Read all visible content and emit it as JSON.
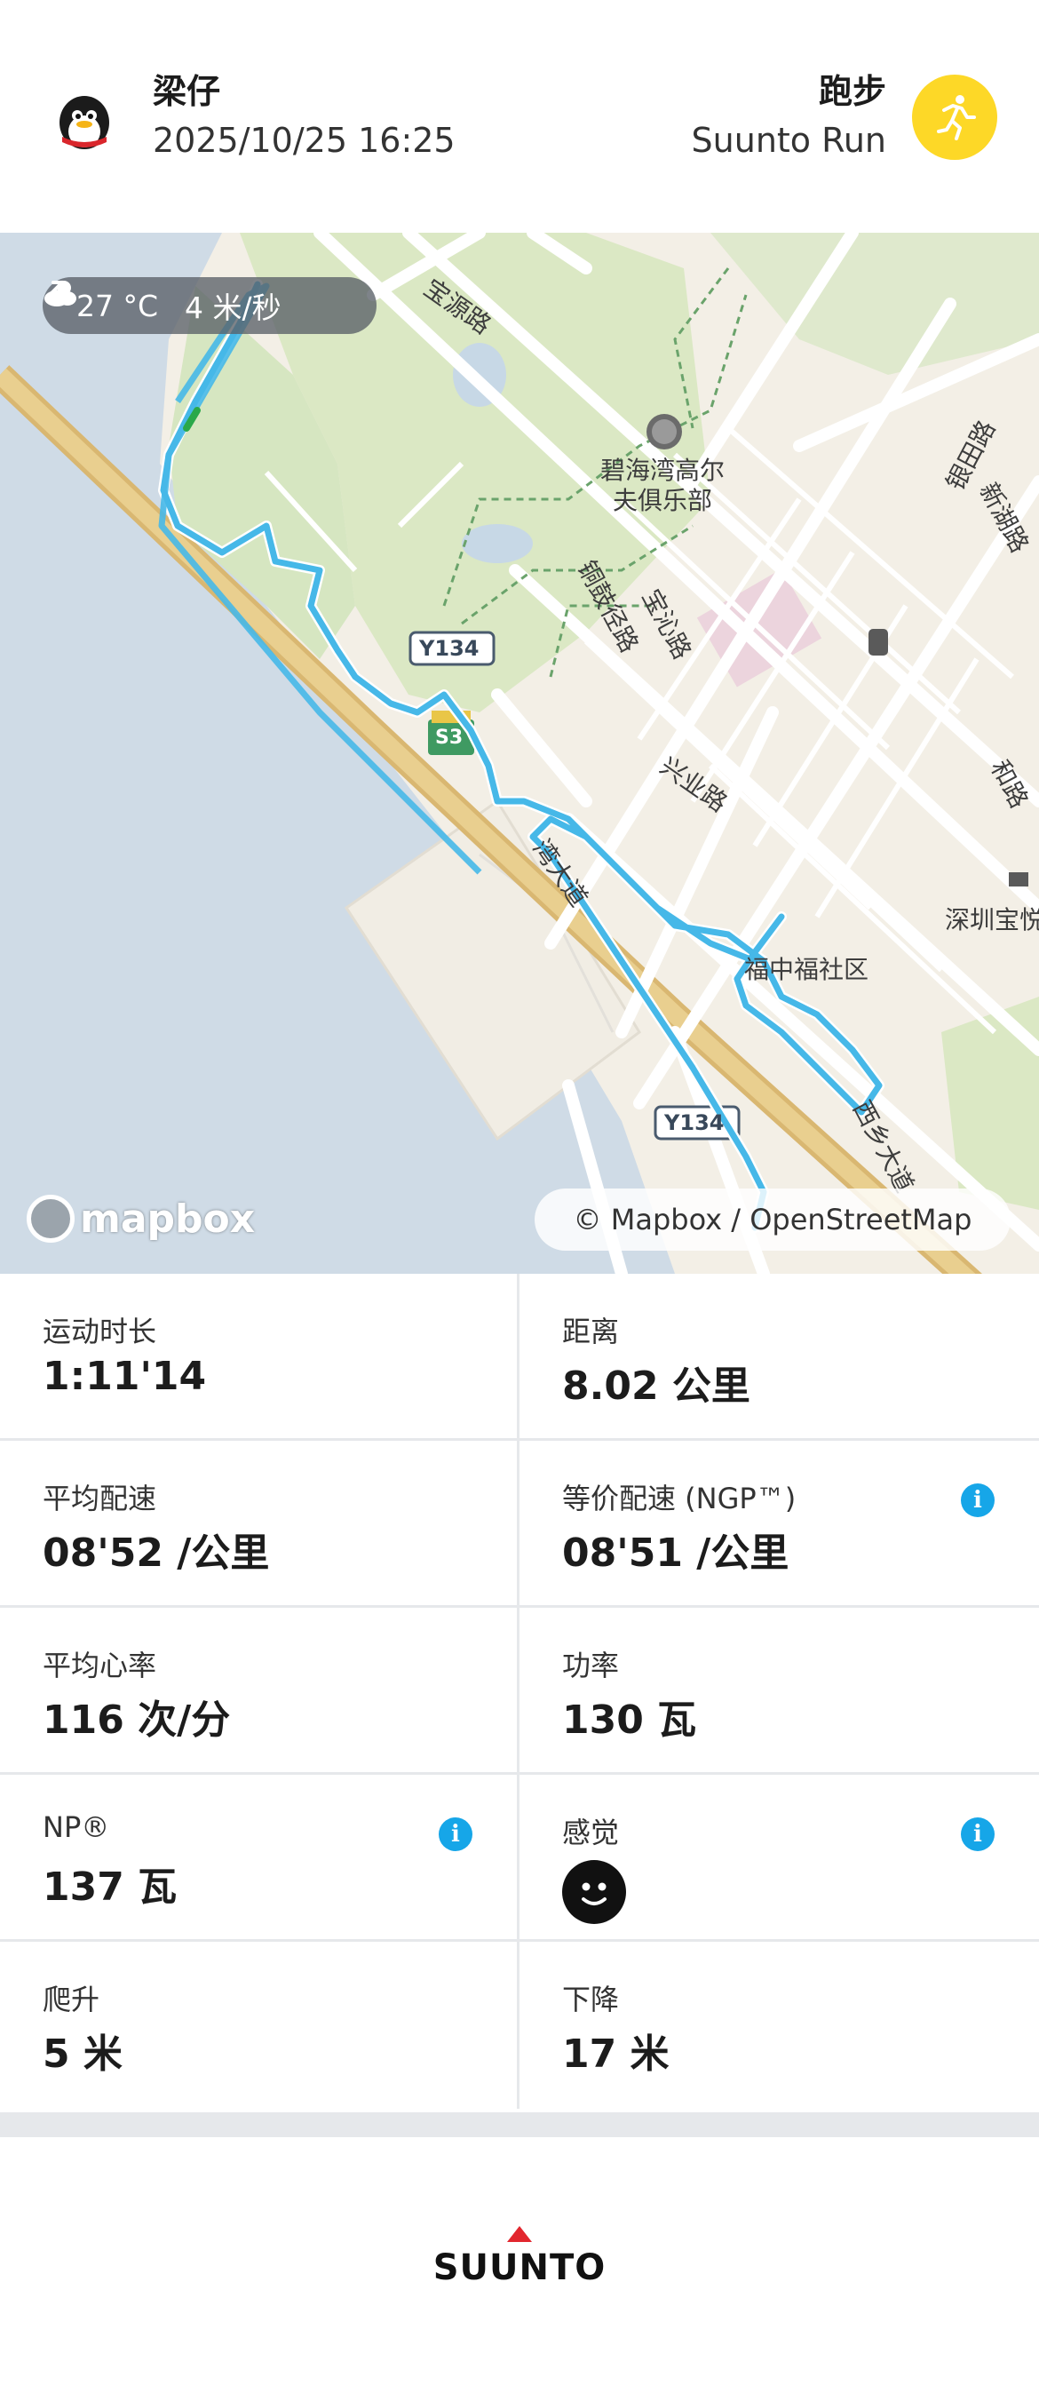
{
  "header": {
    "user_name": "梁仔",
    "datetime": "2025/10/25 16:25",
    "sport": "跑步",
    "sport_mode": "Suunto Run",
    "sport_icon": "running-person-icon",
    "accent": "#fdd827"
  },
  "map": {
    "weather_temp": "27 °C",
    "wind": "4 米/秒",
    "logo": "mapbox",
    "attribution": "© Mapbox / OpenStreetMap",
    "route_color": "#46b8e8",
    "labels": {
      "baoyuan_road": "宝源路",
      "golf_club_1": "碧海湾高尔",
      "golf_club_2": "夫俱乐部",
      "yintian_road": "银田路",
      "xinhu_road": "新湖路",
      "tonggu_road": "铜鼓径路",
      "baoqin_road": "宝沁路",
      "xingye_road": "兴业路",
      "he_road": "和路",
      "shenzhen_bao": "深圳宝悦",
      "fuzhong_community": "福中福社区",
      "xixiang_avenue": "西乡大道",
      "y134_1": "Y134",
      "y134_2": "Y134",
      "s3": "S3",
      "bay_road": "湾大道"
    }
  },
  "stats": [
    {
      "label": "运动时长",
      "value": "1:11'14"
    },
    {
      "label": "距离",
      "value": "8.02 公里"
    },
    {
      "label": "平均配速",
      "value": "08'52 /公里"
    },
    {
      "label": "等价配速 (NGP™)",
      "value": "08'51 /公里"
    },
    {
      "label": "平均心率",
      "value": "116 次/分"
    },
    {
      "label": "功率",
      "value": "130 瓦"
    },
    {
      "label": "NP®",
      "value": "137 瓦"
    },
    {
      "label": "感觉",
      "value": ""
    },
    {
      "label": "爬升",
      "value": "5 米"
    },
    {
      "label": "下降",
      "value": "17 米"
    }
  ],
  "footer": {
    "brand": "SUUNTO"
  }
}
